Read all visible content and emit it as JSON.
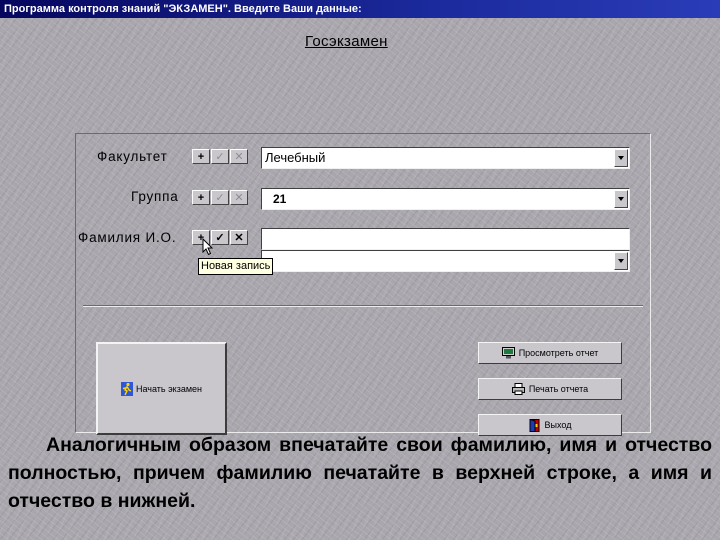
{
  "window": {
    "title": "Программа контроля знаний \"ЭКЗАМЕН\". Введите Ваши данные:"
  },
  "page_title": "Госэкзамен",
  "form": {
    "faculty": {
      "label": "Факультет",
      "value": "Лечебный"
    },
    "group": {
      "label": "Группа",
      "value": "21"
    },
    "name": {
      "label": "Фамилия И.О.",
      "surname_value": "",
      "initials_value": ""
    },
    "buttons": {
      "add": "+",
      "confirm": "✓",
      "cancel": "✕"
    }
  },
  "tooltip": "Новая запись",
  "actions": {
    "start_exam": "Начать экзамен",
    "view_report": "Просмотреть отчет",
    "print_report": "Печать отчета",
    "exit": "Выход"
  },
  "instruction": "Аналогичным образом впечатайте свои фамилию, имя и отчество полностью, причем фамилию печатайте в верхней строке, а имя и отчество в нижней.",
  "icons": {
    "start": "running-man-icon",
    "view": "monitor-icon",
    "print": "printer-icon",
    "exit": "exit-door-icon"
  },
  "colors": {
    "titlebar": "#1b2a9c",
    "background": "#a9a7ad",
    "button_face": "#c9c7cc",
    "tooltip": "#ffffe1"
  }
}
